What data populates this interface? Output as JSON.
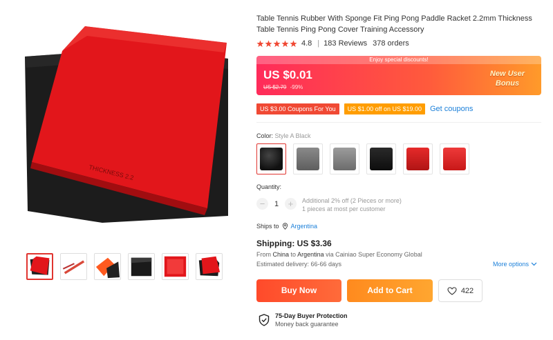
{
  "product": {
    "title": "Table Tennis Rubber With Sponge Fit Ping Pong Paddle Racket 2.2mm Thickness Table Tennis Ping Pong Cover Training Accessory",
    "rating": "4.8",
    "star_count": 5,
    "reviews": "183 Reviews",
    "orders": "378 orders",
    "rubber_text": "THICKNESS 2.2"
  },
  "price": {
    "promo_strip": "Enjoy special discounts!",
    "current": "US $0.01",
    "original": "US $2.79",
    "discount": "-99%",
    "bonus_line1": "New User",
    "bonus_line2": "Bonus"
  },
  "coupons": {
    "coupon1": "US $3.00 Coupons For You",
    "coupon2": "US $1.00 off on US $19.00",
    "get_coupons": "Get coupons"
  },
  "color": {
    "label": "Color:",
    "value": "Style A Black",
    "swatches": [
      {
        "name": "style-a-black",
        "color": "#1d1d1d"
      },
      {
        "name": "style-b-gray",
        "color": "#7a7a7a"
      },
      {
        "name": "style-c-gray",
        "color": "#8e8e8e"
      },
      {
        "name": "style-d-black",
        "color": "#151515"
      },
      {
        "name": "style-e-red",
        "color": "#d61f1f"
      },
      {
        "name": "style-f-red",
        "color": "#e02626"
      }
    ]
  },
  "quantity": {
    "label": "Quantity:",
    "minus": "−",
    "value": "1",
    "plus": "+",
    "note1": "Additional 2% off (2 Pieces or more)",
    "note2": "1 pieces at most per customer"
  },
  "shipping": {
    "ships_to_label": "Ships to",
    "country": "Argentina",
    "cost": "Shipping: US $3.36",
    "from_prefix": "From",
    "from": "China",
    "to_prefix": "to",
    "to": "Argentina",
    "via": "via Cainiao Super Economy Global",
    "delivery": "Estimated delivery: 66-66 days",
    "more_options": "More options"
  },
  "actions": {
    "buy_now": "Buy Now",
    "add_to_cart": "Add to Cart",
    "wishlist_count": "422"
  },
  "protection": {
    "title": "75-Day Buyer Protection",
    "subtitle": "Money back guarantee"
  },
  "colors": {
    "accent": "#e0342f",
    "link": "#1a7fd9",
    "star": "#f04934"
  }
}
